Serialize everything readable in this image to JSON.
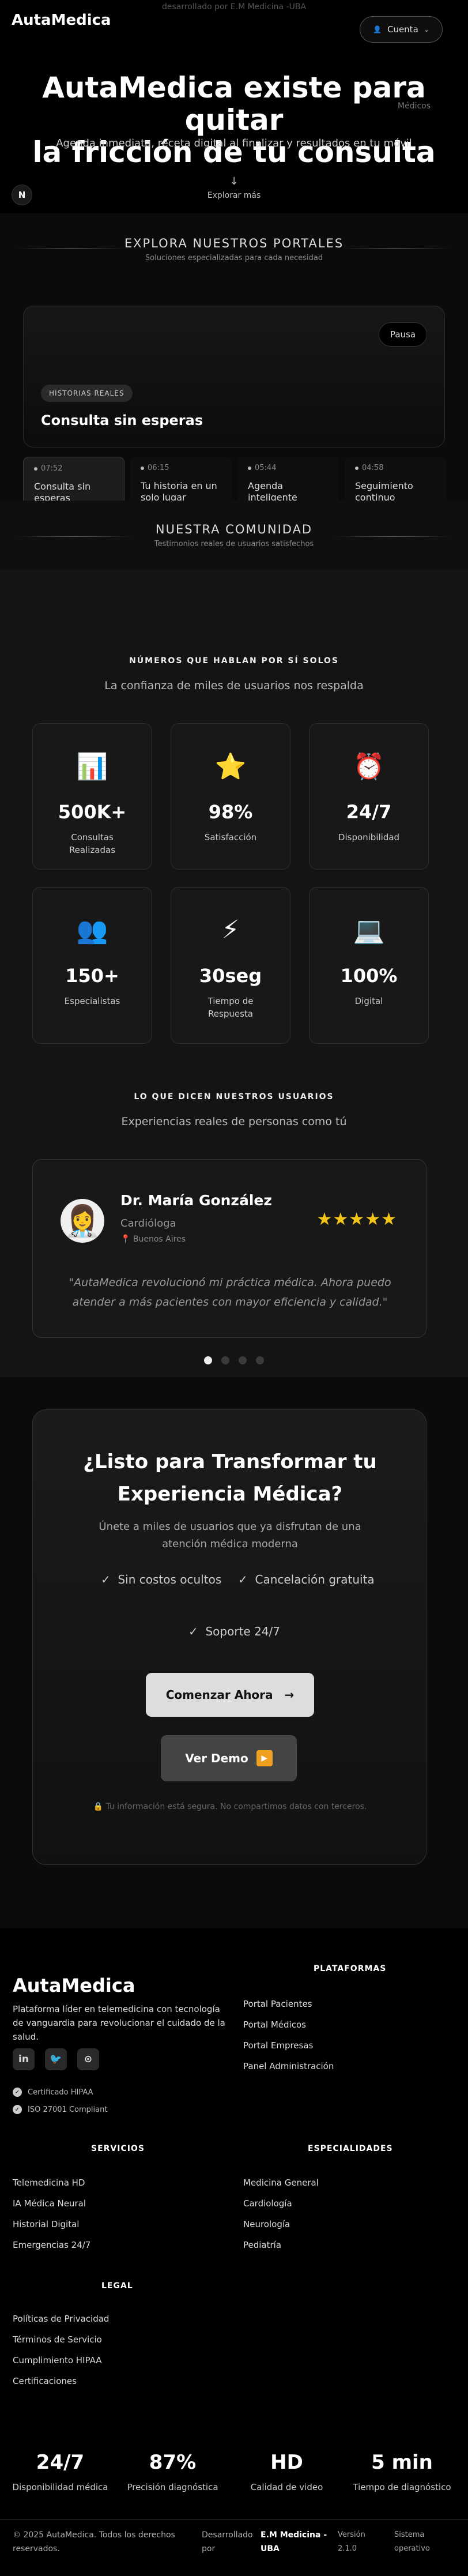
{
  "header": {
    "credit": "desarrollado por E.M Medicina -UBA",
    "brand": "AutaMedica",
    "account": "Cuenta"
  },
  "hero": {
    "title_line1": "AutaMedica existe para quitar",
    "title_line2": "la fricción de tu consulta",
    "subtitle": "Agenda inmediata, receta digital al finalizar y resultados en tu móvil",
    "side_tag": "Médicos",
    "scroll_hint": "Explorar más",
    "avatar_letter": "N"
  },
  "portals": {
    "heading": "EXPLORA NUESTROS PORTALES",
    "sub": "Soluciones especializadas para cada necesidad",
    "pause": "Pausa",
    "pill": "HISTORIAS REALES",
    "title": "Consulta sin esperas",
    "tabs": [
      {
        "time": "07:52",
        "label": "Consulta sin esperas"
      },
      {
        "time": "06:15",
        "label": "Tu historia en un solo lugar"
      },
      {
        "time": "05:44",
        "label": "Agenda inteligente"
      },
      {
        "time": "04:58",
        "label": "Seguimiento continuo"
      }
    ]
  },
  "community": {
    "heading": "NUESTRA COMUNIDAD",
    "sub": "Testimonios reales de usuarios satisfechos"
  },
  "stats": {
    "eyebrow": "NÚMEROS QUE HABLAN POR SÍ SOLOS",
    "lead": "La confianza de miles de usuarios nos respalda",
    "cards": [
      {
        "icon": "📊",
        "icon_name": "bar-chart-icon",
        "value": "500K+",
        "label": "Consultas Realizadas"
      },
      {
        "icon": "⭐",
        "icon_name": "star-icon",
        "value": "98%",
        "label": "Satisfacción"
      },
      {
        "icon": "⏰",
        "icon_name": "alarm-clock-icon",
        "value": "24/7",
        "label": "Disponibilidad"
      },
      {
        "icon": "👥",
        "icon_name": "users-icon",
        "value": "150+",
        "label": "Especialistas"
      },
      {
        "icon": "⚡",
        "icon_name": "lightning-icon",
        "value": "30seg",
        "label": "Tiempo de Respuesta"
      },
      {
        "icon": "💻",
        "icon_name": "laptop-icon",
        "value": "100%",
        "label": "Digital"
      }
    ]
  },
  "testimonials": {
    "eyebrow": "LO QUE DICEN NUESTROS USUARIOS",
    "lead": "Experiencias reales de personas como tú",
    "avatar": "👩‍⚕️",
    "name": "Dr. María González",
    "role": "Cardióloga",
    "location": "Buenos Aires",
    "stars": "★★★★★",
    "quote": "\"AutaMedica revolucionó mi práctica médica. Ahora puedo atender a más pacientes con mayor eficiencia y calidad.\""
  },
  "cta": {
    "title_line1": "¿Listo para Transformar tu",
    "title_line2": "Experiencia Médica?",
    "sub": "Únete a miles de usuarios que ya disfrutan de una atención médica moderna",
    "check1": "Sin costos ocultos",
    "check2": "Cancelación gratuita",
    "check3": "Soporte 24/7",
    "primary": "Comenzar Ahora",
    "secondary": "Ver Demo",
    "secure": "Tu información está segura. No compartimos datos con terceros."
  },
  "footer": {
    "brand": "AutaMedica",
    "desc": "Plataforma líder en telemedicina con tecnología de vanguardia para revolucionar el cuidado de la salud.",
    "cert1": "Certificado HIPAA",
    "cert2": "ISO 27001 Compliant",
    "plataformas": {
      "title": "PLATAFORMAS",
      "items": [
        "Portal Pacientes",
        "Portal Médicos",
        "Portal Empresas",
        "Panel Administración"
      ]
    },
    "servicios": {
      "title": "SERVICIOS",
      "items": [
        "Telemedicina HD",
        "IA Médica Neural",
        "Historial Digital",
        "Emergencias 24/7"
      ]
    },
    "especialidades": {
      "title": "ESPECIALIDADES",
      "items": [
        "Medicina General",
        "Cardiología",
        "Neurología",
        "Pediatría"
      ]
    },
    "legal": {
      "title": "LEGAL",
      "items": [
        "Políticas de Privacidad",
        "Términos de Servicio",
        "Cumplimiento HIPAA",
        "Certificaciones"
      ]
    },
    "kpis": [
      {
        "value": "24/7",
        "label": "Disponibilidad médica"
      },
      {
        "value": "87%",
        "label": "Precisión diagnóstica"
      },
      {
        "value": "HD",
        "label": "Calidad de video"
      },
      {
        "value": "5 min",
        "label": "Tiempo de diagnóstico"
      }
    ],
    "copyright": "© 2025 AutaMedica. Todos los derechos reservados.",
    "dev_label": "Desarrollado por",
    "dev_name": "E.M Medicina - UBA",
    "version": "Versión 2.1.0",
    "status": "Sistema operativo"
  }
}
